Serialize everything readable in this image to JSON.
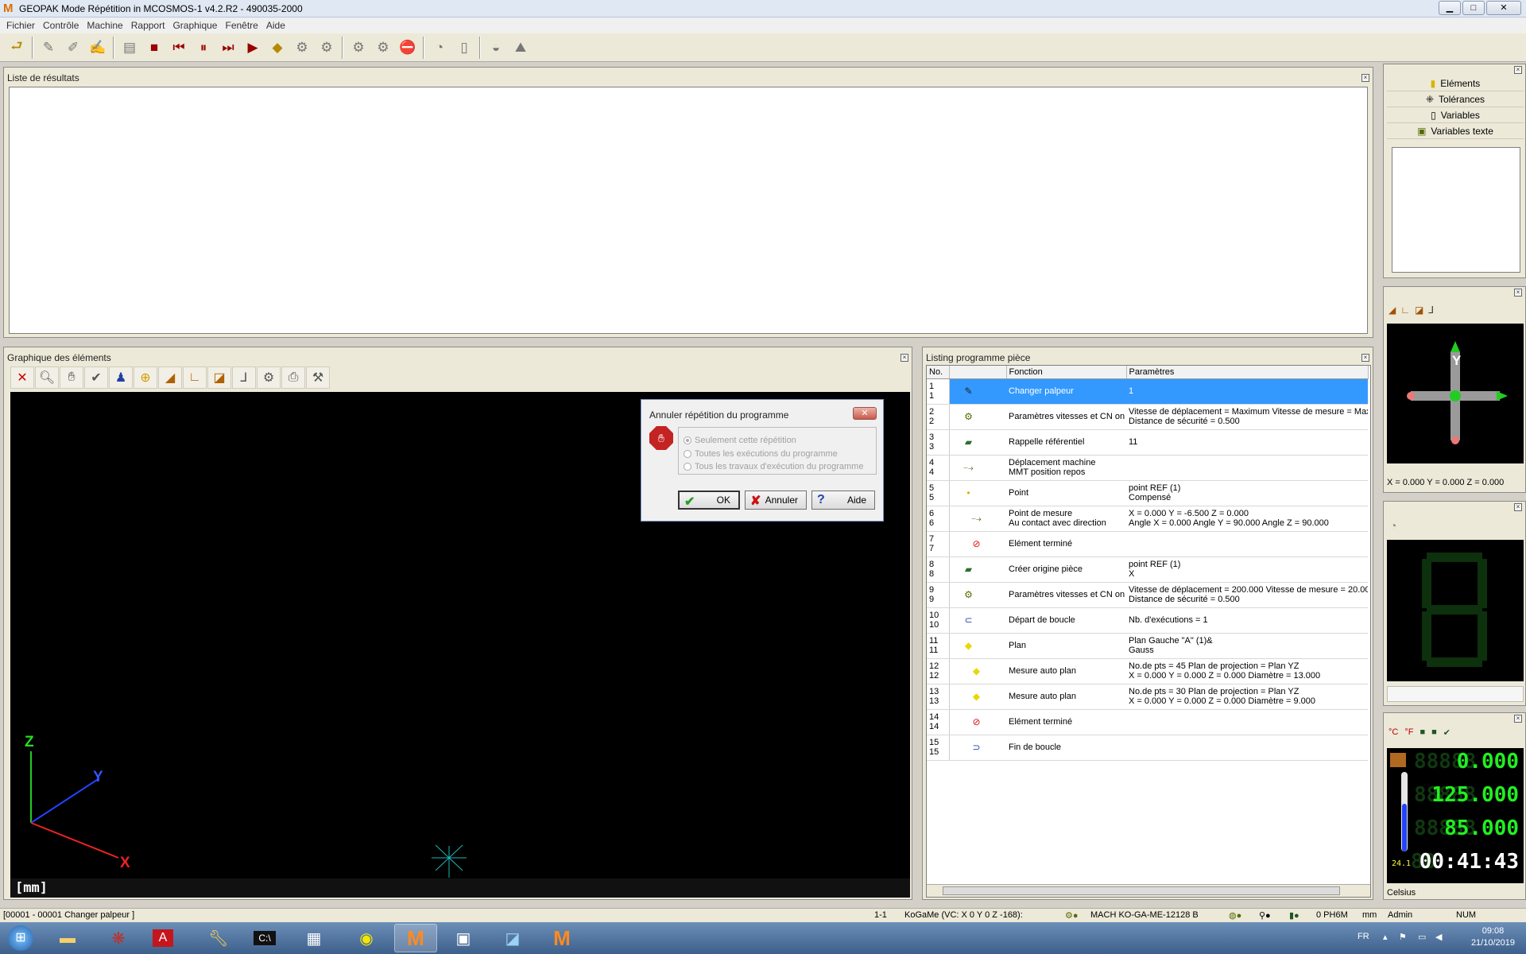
{
  "window": {
    "title": "GEOPAK Mode Répétition in MCOSMOS-1 v4.2.R2   - 490035-2000",
    "minimize": "▁",
    "maximize": "□",
    "close": "✕"
  },
  "menu": [
    "Fichier",
    "Contrôle",
    "Machine",
    "Rapport",
    "Graphique",
    "Fenêtre",
    "Aide"
  ],
  "toolbar": {
    "icons": [
      "exit-icon",
      "probe-icon",
      "probe-change-icon",
      "probe-list-icon",
      "program-icon",
      "stop-icon",
      "first-step-icon",
      "pause-icon",
      "next-step-icon",
      "play-icon",
      "warning-skip-icon",
      "gear-icon",
      "gear-alt-icon",
      "gear-multi-icon",
      "gear-multi-alt-icon",
      "stop-gear-icon",
      "gauge-icon",
      "ruler-icon",
      "sphere-icon",
      "stairs-icon"
    ]
  },
  "results_panel": {
    "title": "Liste de résultats"
  },
  "graph_panel": {
    "title": "Graphique des éléments",
    "unit_label": "[mm]",
    "axis_z": "Z",
    "axis_y": "Y",
    "axis_x": "X"
  },
  "listing_panel": {
    "title": "Listing programme pièce",
    "col_no": "No.",
    "col_fonction": "Fonction",
    "col_parametres": "Paramètres",
    "rows": [
      {
        "no": "1",
        "fn": "Changer palpeur",
        "p1": "1",
        "p2": "",
        "icon": "probe-icon"
      },
      {
        "no": "2",
        "fn": "Paramètres vitesses et CN on",
        "p1": "Vitesse de déplacement = Maximum  Vitesse de mesure = Maxi",
        "p2": "Distance de sécurité = 0.500",
        "icon": "speed-params-icon"
      },
      {
        "no": "3",
        "fn": "Rappelle référentiel",
        "p1": "11",
        "p2": "",
        "icon": "reference-icon"
      },
      {
        "no": "4",
        "fn": "Déplacement machine",
        "fn2": "MMT position repos",
        "p1": "",
        "p2": "",
        "icon": "machine-move-icon"
      },
      {
        "no": "5",
        "fn": "Point",
        "p1": "point REF (1)",
        "p2": "Compensé",
        "icon": "point-icon"
      },
      {
        "no": "6",
        "fn": "Point de mesure",
        "fn2": "Au contact avec direction",
        "p1": "X = 0.000  Y = -6.500  Z = 0.000",
        "p2": "Angle X = 0.000  Angle Y = 90.000  Angle Z = 90.000",
        "icon": "measure-point-icon"
      },
      {
        "no": "7",
        "fn": "Elément terminé",
        "p1": "",
        "p2": "",
        "icon": "element-done-icon"
      },
      {
        "no": "8",
        "fn": "Créer origine pièce",
        "p1": "point REF (1)",
        "p2": "X",
        "icon": "origin-icon"
      },
      {
        "no": "9",
        "fn": "Paramètres vitesses et CN on",
        "p1": "Vitesse de déplacement = 200.000  Vitesse de mesure = 20.00",
        "p2": "Distance de sécurité = 0.500",
        "icon": "speed-params-icon"
      },
      {
        "no": "10",
        "fn": "Départ de boucle",
        "p1": "Nb. d'exécutions = 1",
        "p2": "",
        "icon": "loop-start-icon"
      },
      {
        "no": "11",
        "fn": "Plan",
        "p1": "Plan Gauche \"A\" (1)&",
        "p2": "Gauss",
        "icon": "plane-icon"
      },
      {
        "no": "12",
        "fn": "Mesure auto plan",
        "p1": "No.de pts = 45  Plan de projection = Plan YZ",
        "p2": "X = 0.000  Y = 0.000  Z = 0.000 Diamètre = 13.000",
        "icon": "auto-plane-icon"
      },
      {
        "no": "13",
        "fn": "Mesure auto plan",
        "p1": "No.de pts = 30  Plan de projection = Plan YZ",
        "p2": "X = 0.000  Y = 0.000  Z = 0.000 Diamètre = 9.000",
        "icon": "auto-plane-icon"
      },
      {
        "no": "14",
        "fn": "Elément terminé",
        "p1": "",
        "p2": "",
        "icon": "element-done-icon"
      },
      {
        "no": "15",
        "fn": "Fin de boucle",
        "p1": "",
        "p2": "",
        "icon": "loop-end-icon"
      }
    ]
  },
  "dialog": {
    "title": "Annuler répétition du programme",
    "options": [
      "Seulement cette répétition",
      "Toutes les exécutions du programme",
      "Tous les travaux d'exécution du programme"
    ],
    "ok": "OK",
    "cancel": "Annuler",
    "help": "Aide"
  },
  "right_panel": {
    "tabs": [
      "Eléments",
      "Tolérances",
      "Variables",
      "Variables texte"
    ],
    "probe_axis": "Y",
    "coords": "X = 0.000 Y = 0.000 Z = 0.000",
    "dro_x": "0.000",
    "dro_y": "125.000",
    "dro_z": "85.000",
    "timer": "00:41:43",
    "temp": "24.1",
    "celsius": "Celsius",
    "temp_units": [
      "°C",
      "°F"
    ]
  },
  "statusbar": {
    "left": "[00001 - 00001 Changer palpeur ]",
    "pos": "1-1",
    "kogame": "KoGaMe (VC: X 0 Y 0 Z -168):",
    "mach": "MACH KO-GA-ME-12128 B",
    "probe": "0 PH6M",
    "unit": "mm",
    "user": "Admin",
    "num": "NUM"
  },
  "taskbar": {
    "lang": "FR",
    "time": "09:08",
    "date": "21/10/2019"
  }
}
